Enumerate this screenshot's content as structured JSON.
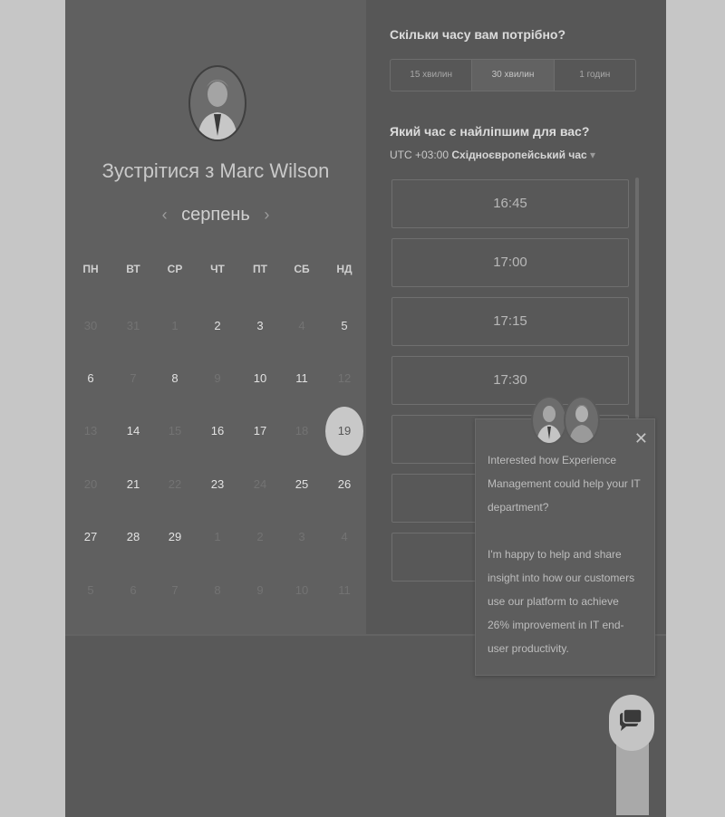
{
  "calendar": {
    "title": "Зустрітися з Marc Wilson",
    "month": "серпень",
    "weekdays": [
      "ПН",
      "ВТ",
      "СР",
      "ЧТ",
      "ПТ",
      "СБ",
      "НД"
    ],
    "days": [
      [
        {
          "d": "30",
          "s": "muted"
        },
        {
          "d": "31",
          "s": "muted"
        },
        {
          "d": "1",
          "s": "muted"
        },
        {
          "d": "2",
          "s": "active"
        },
        {
          "d": "3",
          "s": "active"
        },
        {
          "d": "4",
          "s": "muted"
        },
        {
          "d": "5",
          "s": "active"
        }
      ],
      [
        {
          "d": "6",
          "s": "active"
        },
        {
          "d": "7",
          "s": "muted"
        },
        {
          "d": "8",
          "s": "active"
        },
        {
          "d": "9",
          "s": "muted"
        },
        {
          "d": "10",
          "s": "active"
        },
        {
          "d": "11",
          "s": "active"
        },
        {
          "d": "12",
          "s": "muted"
        }
      ],
      [
        {
          "d": "13",
          "s": "muted"
        },
        {
          "d": "14",
          "s": "active"
        },
        {
          "d": "15",
          "s": "muted"
        },
        {
          "d": "16",
          "s": "active"
        },
        {
          "d": "17",
          "s": "active"
        },
        {
          "d": "18",
          "s": "muted"
        },
        {
          "d": "19",
          "s": "selected"
        }
      ],
      [
        {
          "d": "20",
          "s": "muted"
        },
        {
          "d": "21",
          "s": "active"
        },
        {
          "d": "22",
          "s": "muted"
        },
        {
          "d": "23",
          "s": "active"
        },
        {
          "d": "24",
          "s": "muted"
        },
        {
          "d": "25",
          "s": "active"
        },
        {
          "d": "26",
          "s": "active"
        }
      ],
      [
        {
          "d": "27",
          "s": "active"
        },
        {
          "d": "28",
          "s": "active"
        },
        {
          "d": "29",
          "s": "active"
        },
        {
          "d": "1",
          "s": "muted"
        },
        {
          "d": "2",
          "s": "muted"
        },
        {
          "d": "3",
          "s": "muted"
        },
        {
          "d": "4",
          "s": "muted"
        }
      ],
      [
        {
          "d": "5",
          "s": "muted"
        },
        {
          "d": "6",
          "s": "muted"
        },
        {
          "d": "7",
          "s": "muted"
        },
        {
          "d": "8",
          "s": "muted"
        },
        {
          "d": "9",
          "s": "muted"
        },
        {
          "d": "10",
          "s": "muted"
        },
        {
          "d": "11",
          "s": "muted"
        }
      ]
    ]
  },
  "booking": {
    "duration_question": "Скільки часу вам потрібно?",
    "durations": [
      "15 хвилин",
      "30 хвилин",
      "1 годин"
    ],
    "selected_duration": "30 хвилин",
    "time_question": "Який час є найліпшим для вас?",
    "tz_offset": "UTC +03:00",
    "tz_name": "Східноєвропейський час",
    "tz_caret": "▾",
    "slots": [
      "16:45",
      "17:00",
      "17:15",
      "17:30",
      "",
      "",
      ""
    ]
  },
  "popup": {
    "message_1": "Interested how Experience Management could help your IT department?",
    "message_2": "I'm happy to help and share insight into how our customers use our platform to achieve 26% improvement in IT end-user productivity.",
    "close_glyph": "✕"
  },
  "nav": {
    "prev": "‹",
    "next": "›"
  },
  "icons": {
    "chat": "chat-bubbles-icon",
    "close": "close-icon"
  }
}
